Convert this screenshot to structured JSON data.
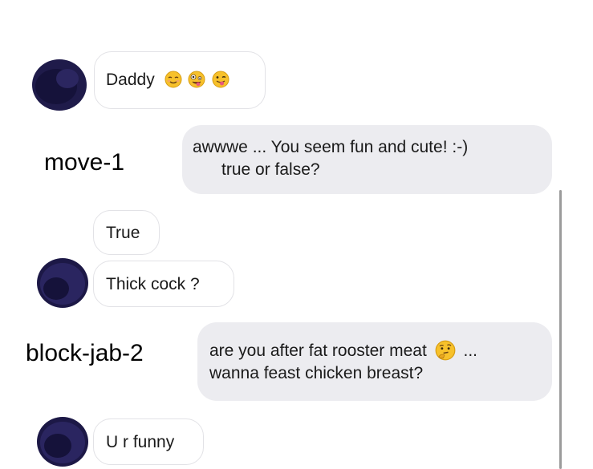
{
  "messages": [
    {
      "sender": "them",
      "text": "Daddy",
      "emoji": [
        "relieved-face-icon",
        "zany-face-icon",
        "winking-tongue-face-icon"
      ]
    },
    {
      "sender": "me",
      "lines": [
        "awwwe ... You seem fun and cute! :-)",
        "true or false?"
      ]
    },
    {
      "sender": "them",
      "text": "True"
    },
    {
      "sender": "them",
      "text": "Thick cock ?"
    },
    {
      "sender": "me",
      "lines": [
        "are you after fat rooster meat",
        "...",
        "wanna feast chicken breast?"
      ],
      "emoji": [
        "thinking-face-icon"
      ]
    },
    {
      "sender": "them",
      "text": "U r funny"
    }
  ],
  "annotations": {
    "move_1": "move-1",
    "block_jab_2": "block-jab-2"
  },
  "colors": {
    "incoming_bg": "#ffffff",
    "incoming_border": "#e2e2e6",
    "outgoing_bg": "#ececf0",
    "emoji_yellow": "#f7c12b"
  }
}
